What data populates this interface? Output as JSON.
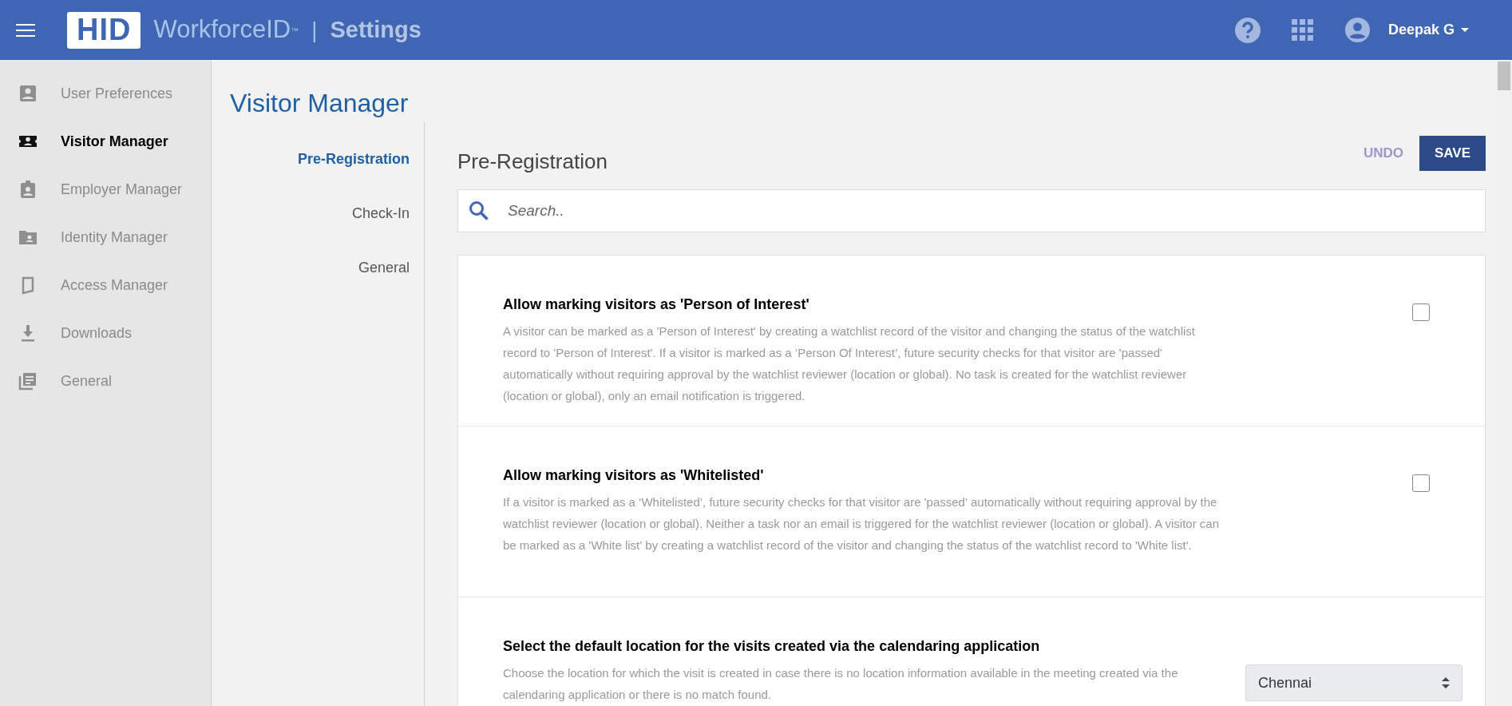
{
  "header": {
    "logo": "HID",
    "product": "WorkforceID",
    "trademark": "™",
    "separator": "|",
    "section": "Settings",
    "user": "Deepak G"
  },
  "sidebar": {
    "items": [
      {
        "label": "User Preferences",
        "selected": false
      },
      {
        "label": "Visitor Manager",
        "selected": true
      },
      {
        "label": "Employer Manager",
        "selected": false
      },
      {
        "label": "Identity Manager",
        "selected": false
      },
      {
        "label": "Access Manager",
        "selected": false
      },
      {
        "label": "Downloads",
        "selected": false
      },
      {
        "label": "General",
        "selected": false
      }
    ]
  },
  "page_title": "Visitor Manager",
  "subnav": [
    {
      "label": "Pre-Registration",
      "selected": true
    },
    {
      "label": "Check-In",
      "selected": false
    },
    {
      "label": "General",
      "selected": false
    }
  ],
  "panel": {
    "title": "Pre-Registration",
    "undo": "UNDO",
    "save": "SAVE",
    "search": {
      "placeholder": "Search.."
    }
  },
  "settings": [
    {
      "kind": "checkbox",
      "title": "Allow marking visitors as 'Person of Interest'",
      "description": "A visitor can be marked as a 'Person of Interest' by creating a watchlist record of the visitor and changing the status of the watchlist record to 'Person of Interest'. If a visitor is marked as a ‘Person Of Interest’, future security checks for that visitor are 'passed' automatically without requiring approval by the watchlist reviewer (location or global). No task is created for the watchlist reviewer (location or global), only an email notification is triggered.",
      "checked": false
    },
    {
      "kind": "checkbox",
      "title": "Allow marking visitors as 'Whitelisted'",
      "description": "If a visitor is marked as a ‘Whitelisted’, future security checks for that visitor are 'passed' automatically without requiring approval by the watchlist reviewer (location or global). Neither a task nor an email is triggered for the watchlist reviewer (location or global). A visitor can be marked as a 'White list' by creating a watchlist record of the visitor and changing the status of the watchlist record to 'White list'.",
      "checked": false
    },
    {
      "kind": "select",
      "title": "Select the default location for the visits created via the calendaring application",
      "description": "Choose the location for which the visit is created in case there is no location information available in the meeting created via the calendaring application or there is no match found.",
      "value": "Chennai"
    }
  ]
}
